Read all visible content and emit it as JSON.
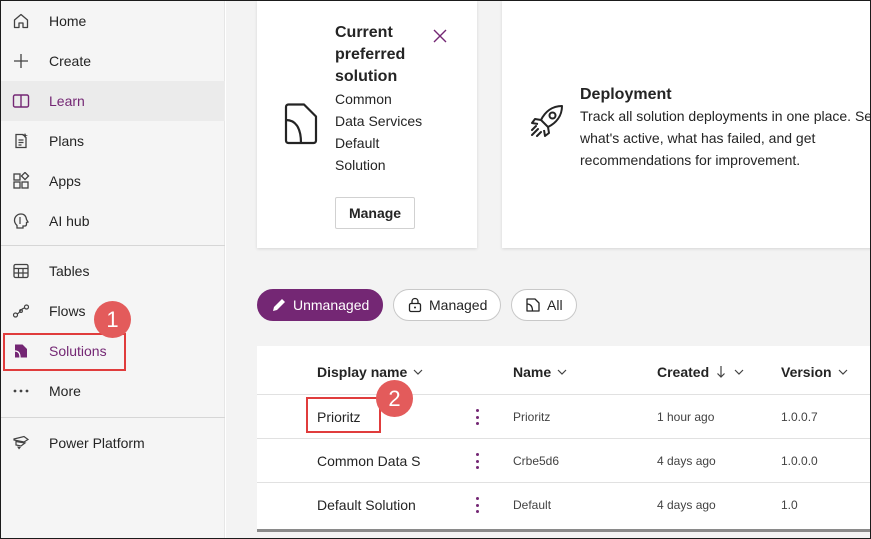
{
  "sidebar": {
    "items": [
      {
        "label": "Home",
        "icon": "home-icon"
      },
      {
        "label": "Create",
        "icon": "plus-icon"
      },
      {
        "label": "Learn",
        "icon": "book-icon"
      },
      {
        "label": "Plans",
        "icon": "plans-icon"
      },
      {
        "label": "Apps",
        "icon": "apps-icon"
      },
      {
        "label": "AI hub",
        "icon": "ai-hub-icon"
      },
      {
        "label": "Tables",
        "icon": "table-icon"
      },
      {
        "label": "Flows",
        "icon": "flow-icon"
      },
      {
        "label": "Solutions",
        "icon": "solutions-icon"
      },
      {
        "label": "More",
        "icon": "ellipsis-icon"
      },
      {
        "label": "Power Platform",
        "icon": "power-platform-icon"
      }
    ]
  },
  "cards": {
    "preferred": {
      "title": "Current preferred solution",
      "body": "Common Data Services Default Solution",
      "button": "Manage",
      "icon": "solution-file-icon"
    },
    "deployment": {
      "title": "Deployment",
      "line1": "Track all solution deployments in one place. See",
      "line2": "what's active, what has failed, and get",
      "line3": "recommendations for improvement.",
      "icon": "rocket-icon"
    }
  },
  "filters": {
    "unmanaged": "Unmanaged",
    "managed": "Managed",
    "all": "All"
  },
  "table": {
    "columns": {
      "display_name": "Display name",
      "name": "Name",
      "created": "Created",
      "version": "Version"
    },
    "rows": [
      {
        "display_name": "Prioritz",
        "name": "Prioritz",
        "created": "1 hour ago",
        "version": "1.0.0.7"
      },
      {
        "display_name": "Common Data S",
        "name": "Crbe5d6",
        "created": "4 days ago",
        "version": "1.0.0.0"
      },
      {
        "display_name": "Default Solution",
        "name": "Default",
        "created": "4 days ago",
        "version": "1.0"
      }
    ]
  },
  "annotations": {
    "step1": "1",
    "step2": "2"
  },
  "colors": {
    "accent": "#742774",
    "annotation": "#e03c3c",
    "badge": "#e35b5b"
  }
}
